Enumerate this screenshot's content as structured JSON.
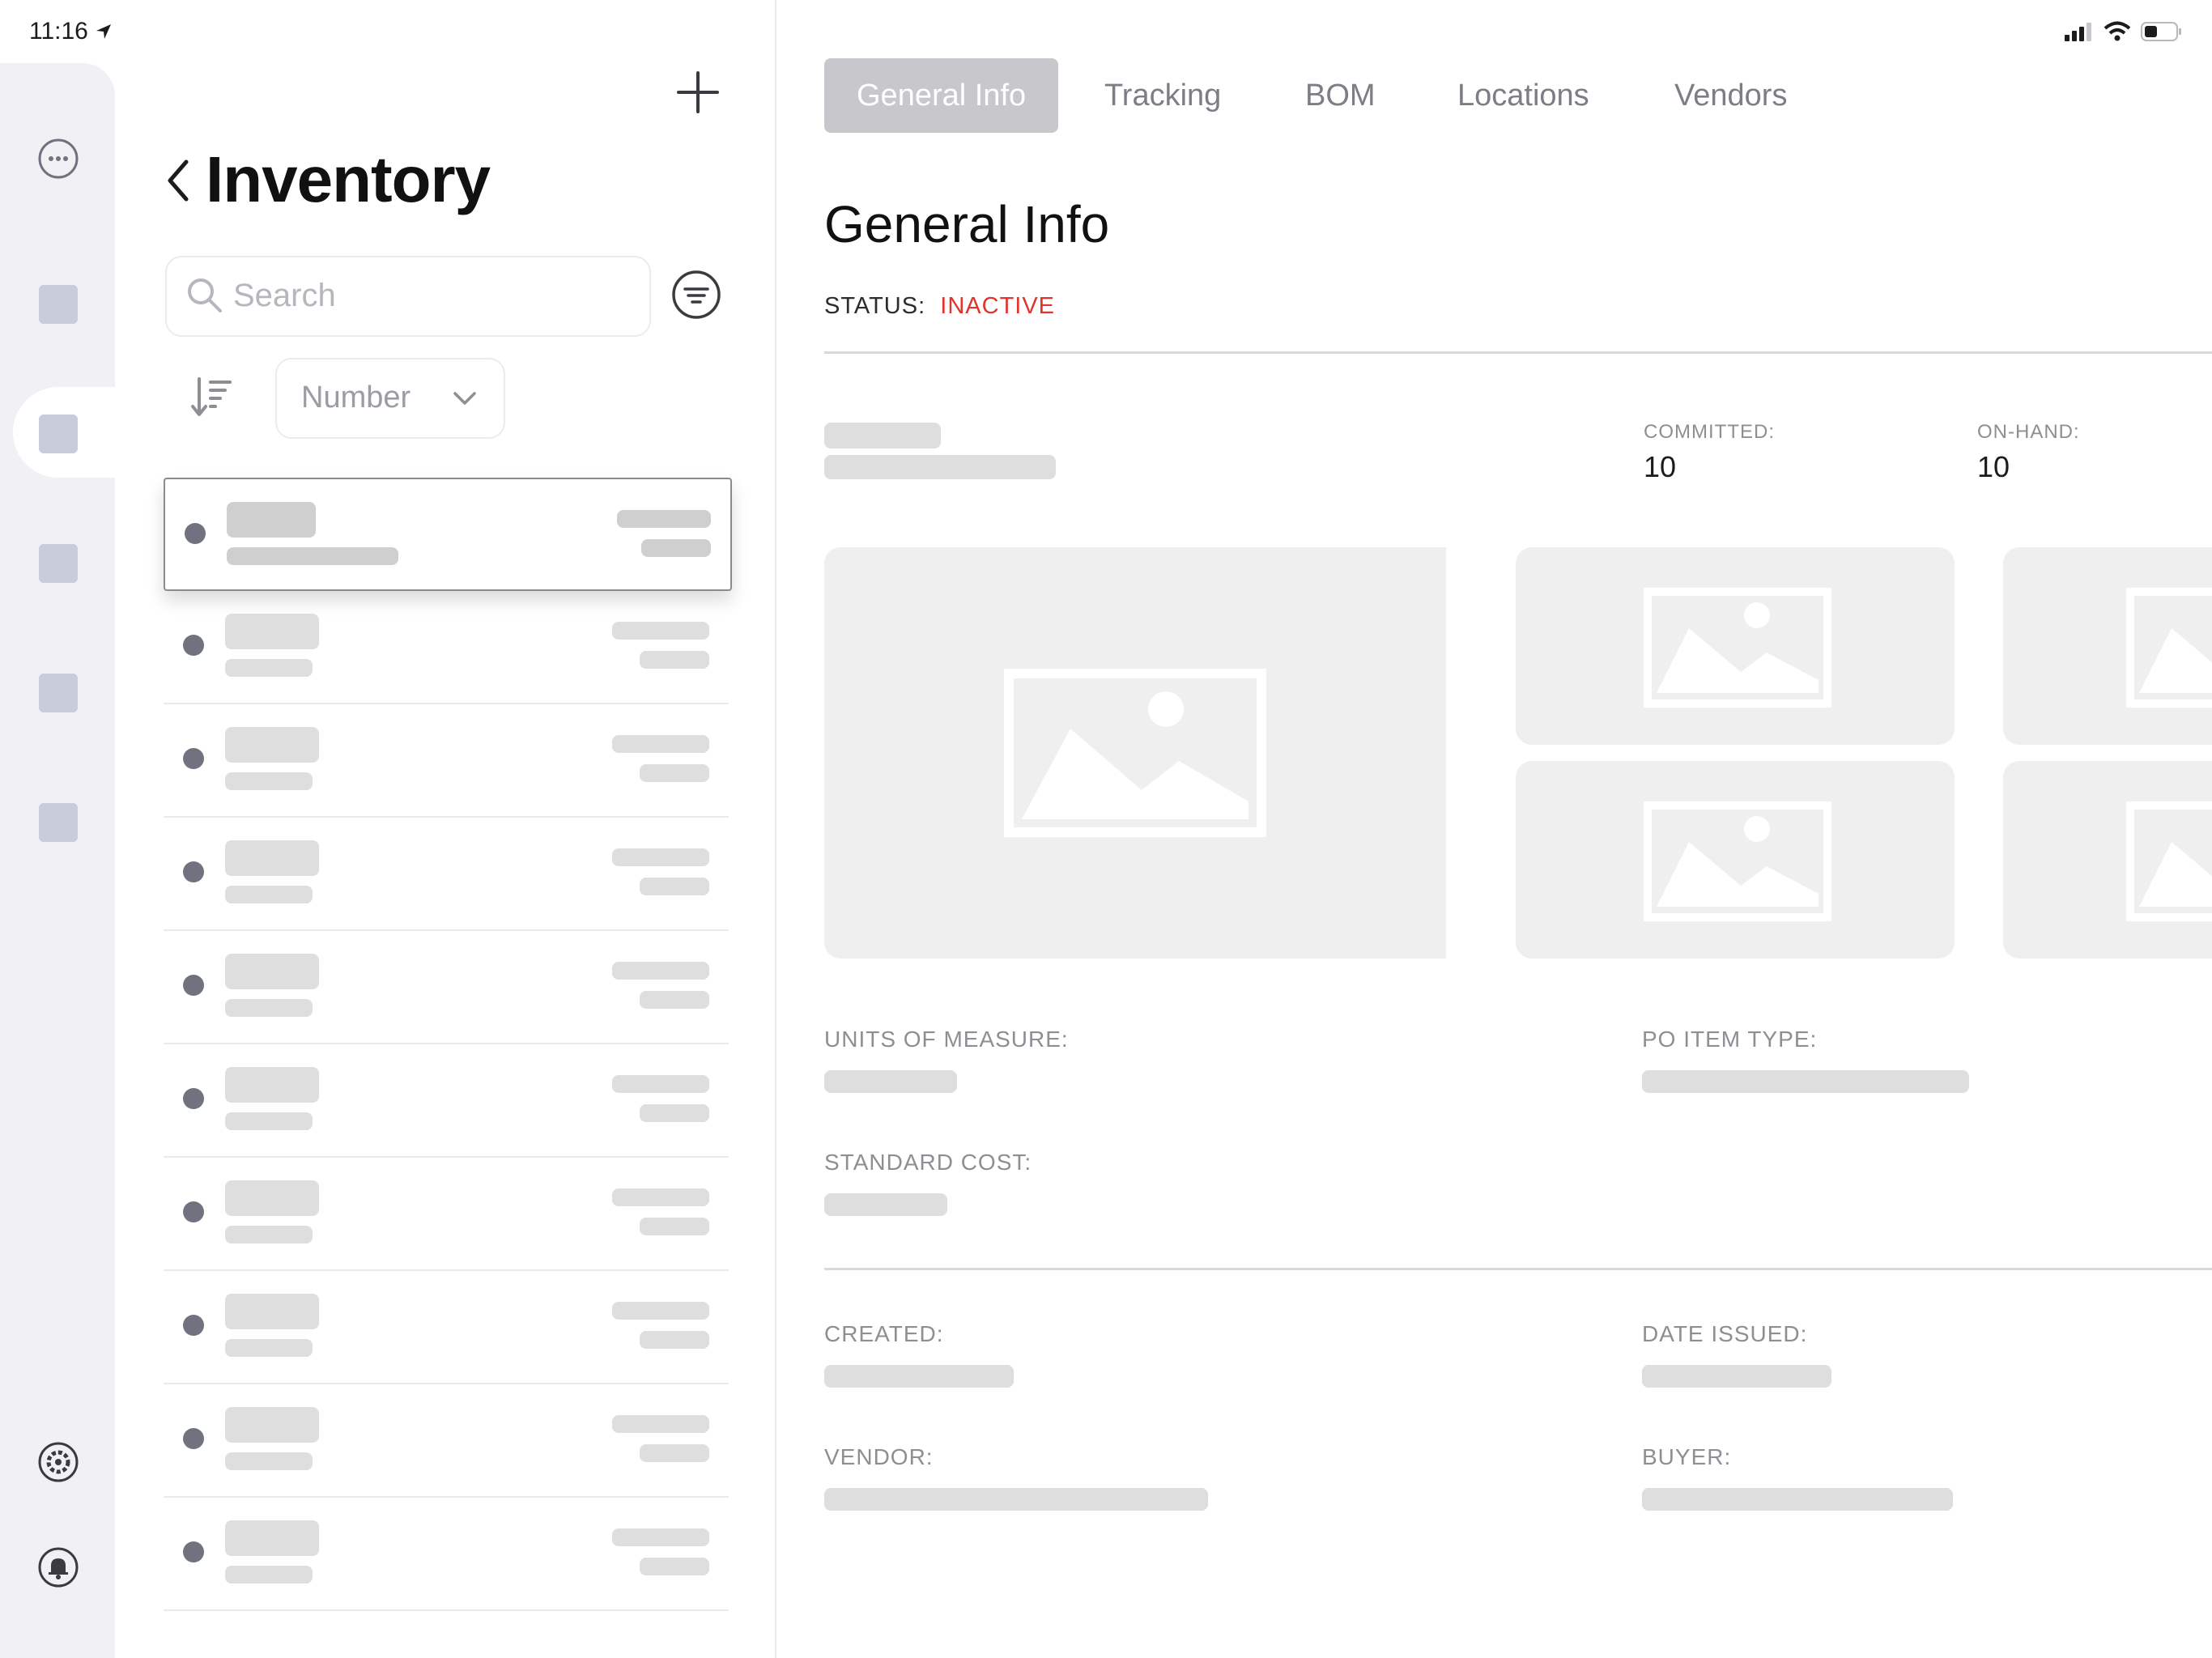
{
  "status_bar": {
    "time": "11:16"
  },
  "rail": {
    "items": [
      "more-menu",
      "nav-item-1",
      "nav-item-2",
      "nav-item-3",
      "nav-item-4",
      "nav-item-5",
      "settings",
      "notifications"
    ]
  },
  "list": {
    "title": "Inventory",
    "search_placeholder": "Search",
    "sort_field": "Number",
    "row_count": 10
  },
  "tabs": [
    {
      "label": "General Info",
      "active": true
    },
    {
      "label": "Tracking",
      "active": false
    },
    {
      "label": "BOM",
      "active": false
    },
    {
      "label": "Locations",
      "active": false
    },
    {
      "label": "Vendors",
      "active": false
    }
  ],
  "detail": {
    "title": "General Info",
    "status_label": "STATUS:",
    "status_value": "INACTIVE",
    "status_color": "#e0342c",
    "committed_label": "COMMITTED:",
    "committed_value": "10",
    "on_hand_label": "ON-HAND:",
    "on_hand_value": "10",
    "units_label": "UNITS OF MEASURE:",
    "po_item_type_label": "PO ITEM TYPE:",
    "standard_cost_label": "STANDARD COST:",
    "created_label": "CREATED:",
    "date_issued_label": "DATE ISSUED:",
    "vendor_label": "VENDOR:",
    "buyer_label": "BUYER:"
  }
}
